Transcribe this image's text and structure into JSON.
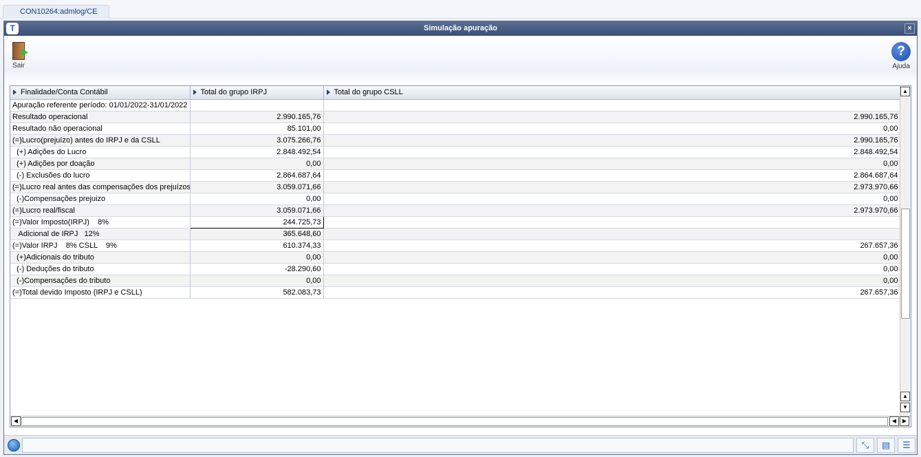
{
  "session_tab": "CON10264:admlog/CE",
  "window": {
    "title": "Simulação apuração",
    "logo_letter": "T",
    "close_glyph": "×"
  },
  "toolbar": {
    "exit_label": "Sair",
    "help_label": "Ajuda",
    "help_glyph": "?"
  },
  "grid": {
    "columns": [
      "Finalidade/Conta Contábil",
      "Total do grupo IRPJ",
      "Total do grupo CSLL"
    ],
    "rows": [
      [
        "Apuração referente período: 01/01/2022-31/01/2022",
        "",
        ""
      ],
      [
        "Resultado operacional",
        "2.990.165,76",
        "2.990.165,76"
      ],
      [
        "Resultado não operacional",
        "85.101,00",
        "0,00"
      ],
      [
        "(=)Lucro(prejuízo) antes do IRPJ e da CSLL",
        "3.075.266,76",
        "2.990.165,76"
      ],
      [
        "  (+) Adições do Lucro",
        "2.848.492,54",
        "2.848.492,54"
      ],
      [
        "  (+) Adições por doação",
        "0,00",
        "0,00"
      ],
      [
        "  (-) Exclusões do lucro",
        "2.864.687,64",
        "2.864.687,64"
      ],
      [
        "(=)Lucro real antes das compensações dos prejuízos",
        "3.059.071,66",
        "2.973.970,66"
      ],
      [
        "  (-)Compensações prejuizo",
        "0,00",
        "0,00"
      ],
      [
        "(=)Lucro real/fiscal",
        "3.059.071,66",
        "2.973.970,66"
      ],
      [
        "(=)Valor Imposto(IRPJ)    8%",
        "244.725,73",
        ""
      ],
      [
        "   Adicional de IRPJ   12%",
        "365.648,60",
        ""
      ],
      [
        "(=)Valor IRPJ    8% CSLL    9%",
        "610.374,33",
        "267.657,36"
      ],
      [
        "  (+)Adicionais do tributo",
        "0,00",
        "0,00"
      ],
      [
        "  (-) Deduções do tributo",
        "-28.290,60",
        "0,00"
      ],
      [
        "  (-)Compensações do tributo",
        "0,00",
        "0,00"
      ],
      [
        "(=)Total devido Imposto (IRPJ e CSLL)",
        "582.083,73",
        "267.657,36"
      ]
    ],
    "selected_cell": [
      10,
      1
    ]
  }
}
